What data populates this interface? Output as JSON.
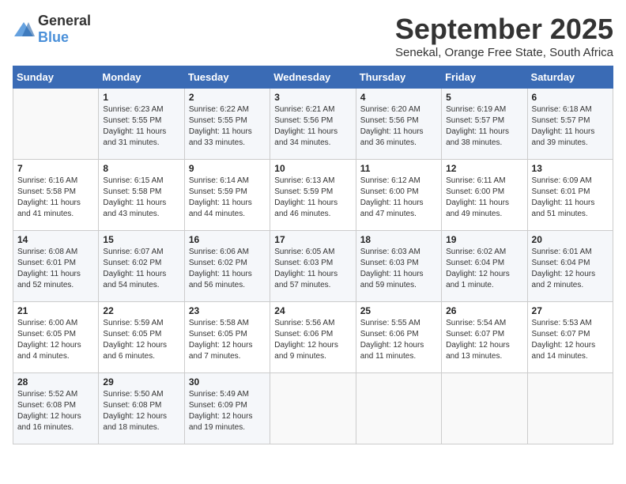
{
  "logo": {
    "general": "General",
    "blue": "Blue"
  },
  "header": {
    "month": "September 2025",
    "location": "Senekal, Orange Free State, South Africa"
  },
  "weekdays": [
    "Sunday",
    "Monday",
    "Tuesday",
    "Wednesday",
    "Thursday",
    "Friday",
    "Saturday"
  ],
  "weeks": [
    [
      {
        "day": "",
        "sunrise": "",
        "sunset": "",
        "daylight": ""
      },
      {
        "day": "1",
        "sunrise": "Sunrise: 6:23 AM",
        "sunset": "Sunset: 5:55 PM",
        "daylight": "Daylight: 11 hours and 31 minutes."
      },
      {
        "day": "2",
        "sunrise": "Sunrise: 6:22 AM",
        "sunset": "Sunset: 5:55 PM",
        "daylight": "Daylight: 11 hours and 33 minutes."
      },
      {
        "day": "3",
        "sunrise": "Sunrise: 6:21 AM",
        "sunset": "Sunset: 5:56 PM",
        "daylight": "Daylight: 11 hours and 34 minutes."
      },
      {
        "day": "4",
        "sunrise": "Sunrise: 6:20 AM",
        "sunset": "Sunset: 5:56 PM",
        "daylight": "Daylight: 11 hours and 36 minutes."
      },
      {
        "day": "5",
        "sunrise": "Sunrise: 6:19 AM",
        "sunset": "Sunset: 5:57 PM",
        "daylight": "Daylight: 11 hours and 38 minutes."
      },
      {
        "day": "6",
        "sunrise": "Sunrise: 6:18 AM",
        "sunset": "Sunset: 5:57 PM",
        "daylight": "Daylight: 11 hours and 39 minutes."
      }
    ],
    [
      {
        "day": "7",
        "sunrise": "Sunrise: 6:16 AM",
        "sunset": "Sunset: 5:58 PM",
        "daylight": "Daylight: 11 hours and 41 minutes."
      },
      {
        "day": "8",
        "sunrise": "Sunrise: 6:15 AM",
        "sunset": "Sunset: 5:58 PM",
        "daylight": "Daylight: 11 hours and 43 minutes."
      },
      {
        "day": "9",
        "sunrise": "Sunrise: 6:14 AM",
        "sunset": "Sunset: 5:59 PM",
        "daylight": "Daylight: 11 hours and 44 minutes."
      },
      {
        "day": "10",
        "sunrise": "Sunrise: 6:13 AM",
        "sunset": "Sunset: 5:59 PM",
        "daylight": "Daylight: 11 hours and 46 minutes."
      },
      {
        "day": "11",
        "sunrise": "Sunrise: 6:12 AM",
        "sunset": "Sunset: 6:00 PM",
        "daylight": "Daylight: 11 hours and 47 minutes."
      },
      {
        "day": "12",
        "sunrise": "Sunrise: 6:11 AM",
        "sunset": "Sunset: 6:00 PM",
        "daylight": "Daylight: 11 hours and 49 minutes."
      },
      {
        "day": "13",
        "sunrise": "Sunrise: 6:09 AM",
        "sunset": "Sunset: 6:01 PM",
        "daylight": "Daylight: 11 hours and 51 minutes."
      }
    ],
    [
      {
        "day": "14",
        "sunrise": "Sunrise: 6:08 AM",
        "sunset": "Sunset: 6:01 PM",
        "daylight": "Daylight: 11 hours and 52 minutes."
      },
      {
        "day": "15",
        "sunrise": "Sunrise: 6:07 AM",
        "sunset": "Sunset: 6:02 PM",
        "daylight": "Daylight: 11 hours and 54 minutes."
      },
      {
        "day": "16",
        "sunrise": "Sunrise: 6:06 AM",
        "sunset": "Sunset: 6:02 PM",
        "daylight": "Daylight: 11 hours and 56 minutes."
      },
      {
        "day": "17",
        "sunrise": "Sunrise: 6:05 AM",
        "sunset": "Sunset: 6:03 PM",
        "daylight": "Daylight: 11 hours and 57 minutes."
      },
      {
        "day": "18",
        "sunrise": "Sunrise: 6:03 AM",
        "sunset": "Sunset: 6:03 PM",
        "daylight": "Daylight: 11 hours and 59 minutes."
      },
      {
        "day": "19",
        "sunrise": "Sunrise: 6:02 AM",
        "sunset": "Sunset: 6:04 PM",
        "daylight": "Daylight: 12 hours and 1 minute."
      },
      {
        "day": "20",
        "sunrise": "Sunrise: 6:01 AM",
        "sunset": "Sunset: 6:04 PM",
        "daylight": "Daylight: 12 hours and 2 minutes."
      }
    ],
    [
      {
        "day": "21",
        "sunrise": "Sunrise: 6:00 AM",
        "sunset": "Sunset: 6:05 PM",
        "daylight": "Daylight: 12 hours and 4 minutes."
      },
      {
        "day": "22",
        "sunrise": "Sunrise: 5:59 AM",
        "sunset": "Sunset: 6:05 PM",
        "daylight": "Daylight: 12 hours and 6 minutes."
      },
      {
        "day": "23",
        "sunrise": "Sunrise: 5:58 AM",
        "sunset": "Sunset: 6:05 PM",
        "daylight": "Daylight: 12 hours and 7 minutes."
      },
      {
        "day": "24",
        "sunrise": "Sunrise: 5:56 AM",
        "sunset": "Sunset: 6:06 PM",
        "daylight": "Daylight: 12 hours and 9 minutes."
      },
      {
        "day": "25",
        "sunrise": "Sunrise: 5:55 AM",
        "sunset": "Sunset: 6:06 PM",
        "daylight": "Daylight: 12 hours and 11 minutes."
      },
      {
        "day": "26",
        "sunrise": "Sunrise: 5:54 AM",
        "sunset": "Sunset: 6:07 PM",
        "daylight": "Daylight: 12 hours and 13 minutes."
      },
      {
        "day": "27",
        "sunrise": "Sunrise: 5:53 AM",
        "sunset": "Sunset: 6:07 PM",
        "daylight": "Daylight: 12 hours and 14 minutes."
      }
    ],
    [
      {
        "day": "28",
        "sunrise": "Sunrise: 5:52 AM",
        "sunset": "Sunset: 6:08 PM",
        "daylight": "Daylight: 12 hours and 16 minutes."
      },
      {
        "day": "29",
        "sunrise": "Sunrise: 5:50 AM",
        "sunset": "Sunset: 6:08 PM",
        "daylight": "Daylight: 12 hours and 18 minutes."
      },
      {
        "day": "30",
        "sunrise": "Sunrise: 5:49 AM",
        "sunset": "Sunset: 6:09 PM",
        "daylight": "Daylight: 12 hours and 19 minutes."
      },
      {
        "day": "",
        "sunrise": "",
        "sunset": "",
        "daylight": ""
      },
      {
        "day": "",
        "sunrise": "",
        "sunset": "",
        "daylight": ""
      },
      {
        "day": "",
        "sunrise": "",
        "sunset": "",
        "daylight": ""
      },
      {
        "day": "",
        "sunrise": "",
        "sunset": "",
        "daylight": ""
      }
    ]
  ]
}
